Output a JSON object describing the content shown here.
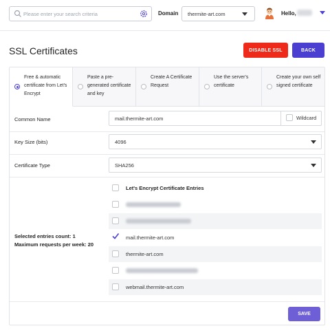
{
  "topbar": {
    "search_placeholder": "Please enter your search criteria",
    "domain_label": "Domain",
    "domain_value": "thermite-art.com",
    "hello_label": "Hello,"
  },
  "header": {
    "title": "SSL Certificates",
    "disable_ssl_label": "DISABLE SSL",
    "back_label": "BACK"
  },
  "tabs": [
    {
      "label": "Free & automatic certificate from Let's Encrypt",
      "selected": true
    },
    {
      "label": "Paste a pre-generated certificate and key",
      "selected": false
    },
    {
      "label": "Create A Certificate Request",
      "selected": false
    },
    {
      "label": "Use the server's certificate",
      "selected": false
    },
    {
      "label": "Create your own self signed certificate",
      "selected": false
    }
  ],
  "form": {
    "common_name_label": "Common Name",
    "common_name_value": "mail.thermite-art.com",
    "wildcard_label": "Wildcard",
    "key_size_label": "Key Size (bits)",
    "key_size_value": "4096",
    "cert_type_label": "Certificate Type",
    "cert_type_value": "SHA256"
  },
  "entries": {
    "header_label": "Let's Encrypt Certificate Entries",
    "items": [
      {
        "label": "",
        "checked": false,
        "blurred": true
      },
      {
        "label": "",
        "checked": false,
        "blurred": true
      },
      {
        "label": "mail.thermite-art.com",
        "checked": true,
        "blurred": false
      },
      {
        "label": "thermite-art.com",
        "checked": false,
        "blurred": false
      },
      {
        "label": "",
        "checked": false,
        "blurred": true
      },
      {
        "label": "webmail.thermite-art.com",
        "checked": false,
        "blurred": false
      }
    ]
  },
  "summary": {
    "selected_count_text": "Selected entries count: 1",
    "max_requests_text": "Maximum requests per week: 20"
  },
  "save_label": "SAVE",
  "colors": {
    "accent": "#4b3fd1",
    "danger": "#ee2b1a",
    "save": "#6f5fd6"
  }
}
